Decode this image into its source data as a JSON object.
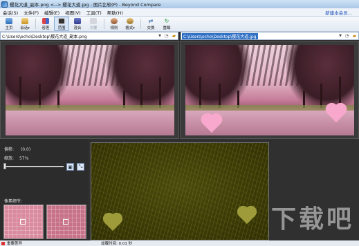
{
  "window": {
    "title": "樱花大道_副本.png <--> 樱花大道.jpg - 图片比较(P) - Beyond Compare"
  },
  "menu": {
    "items": [
      "会话(S)",
      "文件(F)",
      "编辑(E)",
      "视图(V)",
      "工具(T)",
      "帮助(H)"
    ],
    "new_session": "新建本会...",
    "new_session_display": "新建本会员..."
  },
  "toolbar": {
    "home": "主页",
    "session": "会话",
    "all": "容差",
    "diff": "范围",
    "same": "混合",
    "swap_disabled": "次要",
    "rules": "规则",
    "format": "格式",
    "swap": "交换",
    "reload": "重载"
  },
  "paths": {
    "left": "C:\\Users\\echo\\Desktop\\樱花大道_副本.png",
    "right_highlight": "C:\\Users\\echo\\Desktop\\樱花大道.jpg"
  },
  "info": {
    "offset_label": "偏移:",
    "offset_value": "(0,0)",
    "zoom_label": "缩放:",
    "zoom_value": "57%",
    "zoom_level": 0.57,
    "pixel_detail_label": "像素细节:"
  },
  "status": {
    "left_text": "重要差异",
    "load_time": "加载时间: 0.01 秒"
  },
  "watermark": {
    "text": "下载吧"
  },
  "colors": {
    "accent": "#2f6fc4",
    "heart": "#f8a8cc",
    "diff_background": "#3d3c08"
  },
  "icons": {
    "home": "home-icon",
    "session": "session-icon",
    "all": "all-filter-icon",
    "diff": "diff-filter-icon",
    "same": "same-filter-icon",
    "rules": "rules-icon",
    "format": "format-icon",
    "swap": "swap-icon",
    "reload": "reload-icon"
  }
}
